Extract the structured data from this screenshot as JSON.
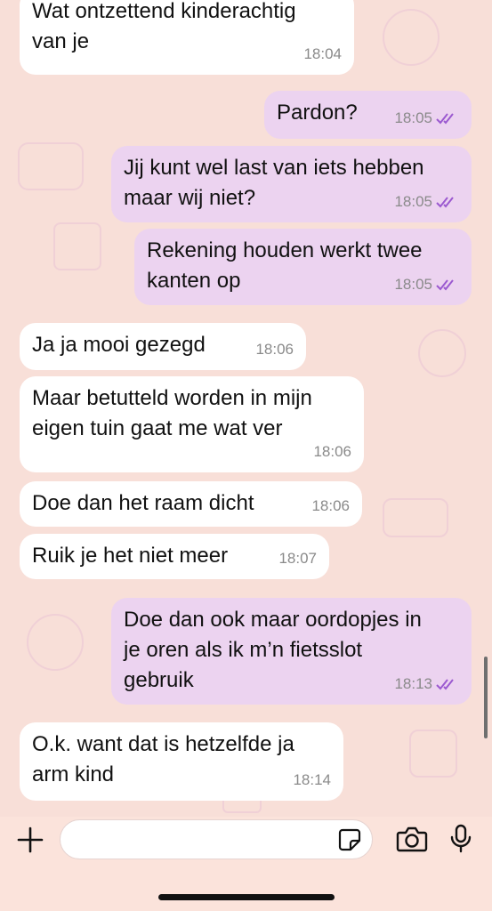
{
  "messages": [
    {
      "direction": "incoming",
      "text": "Wat ontzettend kinderachtig\nvan je",
      "time": "18:04"
    },
    {
      "direction": "outgoing",
      "text": "Pardon?",
      "time": "18:05",
      "status": "read"
    },
    {
      "direction": "outgoing",
      "text": "Jij kunt wel last van iets hebben\nmaar wij niet?",
      "time": "18:05",
      "status": "read"
    },
    {
      "direction": "outgoing",
      "text": "Rekening houden werkt twee\nkanten op",
      "time": "18:05",
      "status": "read"
    },
    {
      "direction": "incoming",
      "text": "Ja ja mooi gezegd",
      "time": "18:06"
    },
    {
      "direction": "incoming",
      "text": "Maar betutteld worden in mijn\neigen tuin gaat me wat ver",
      "time": "18:06"
    },
    {
      "direction": "incoming",
      "text": "Doe dan het raam dicht",
      "time": "18:06"
    },
    {
      "direction": "incoming",
      "text": "Ruik je het niet meer",
      "time": "18:07"
    },
    {
      "direction": "outgoing",
      "text": "Doe dan ook maar oordopjes in\nje oren als ik m’n fietsslot\ngebruik",
      "time": "18:13",
      "status": "read"
    },
    {
      "direction": "incoming",
      "text": "O.k. want dat is hetzelfde ja\narm kind",
      "time": "18:14"
    }
  ],
  "composer": {
    "placeholder": "",
    "icons": [
      "plus-icon",
      "sticker-icon",
      "camera-icon",
      "microphone-icon"
    ]
  },
  "colors": {
    "background": "#f8dfd8",
    "incoming_bubble": "#ffffff",
    "outgoing_bubble": "#ecd3f0",
    "read_ticks": "#9b59d0"
  }
}
